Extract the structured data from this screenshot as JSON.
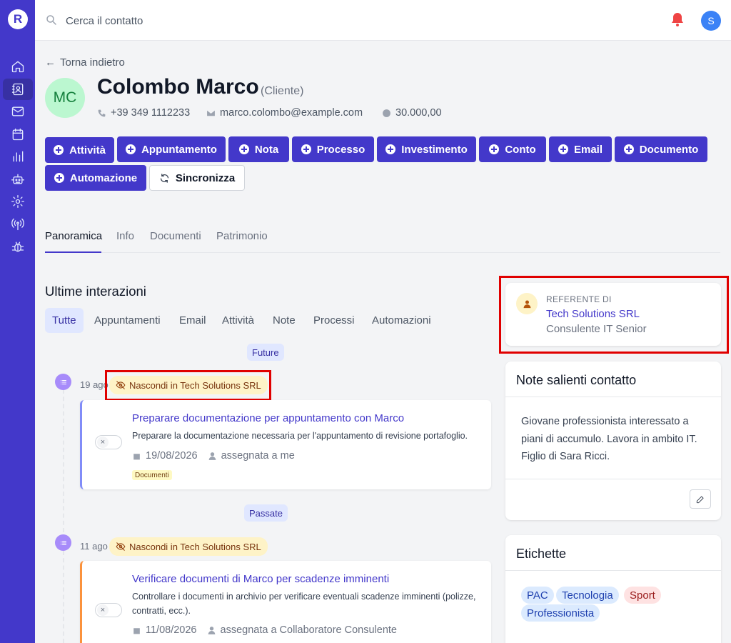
{
  "brand": {
    "logo_letter": "R"
  },
  "search": {
    "placeholder": "Cerca il contatto",
    "value": ""
  },
  "user": {
    "initial": "S"
  },
  "nav": [
    "home-icon",
    "contacts-icon",
    "mail-icon",
    "calendar-icon",
    "chart-icon",
    "robot-icon",
    "settings-icon",
    "antenna-icon",
    "bug-icon"
  ],
  "contact": {
    "back_label": "Torna indietro",
    "initials": "MC",
    "name": "Colombo Marco",
    "type": "(Cliente)",
    "phone": "+39 349 1112233",
    "email": "marco.colombo@example.com",
    "value": "30.000,00"
  },
  "actions": {
    "attivita": "Attività",
    "appuntamento": "Appuntamento",
    "nota": "Nota",
    "processo": "Processo",
    "investimento": "Investimento",
    "conto": "Conto",
    "email": "Email",
    "documento": "Documento",
    "automazione": "Automazione",
    "sincronizza": "Sincronizza"
  },
  "tabs": {
    "panoramica": "Panoramica",
    "info": "Info",
    "documenti": "Documenti",
    "patrimonio": "Patrimonio"
  },
  "interactions": {
    "title": "Ultime interazioni",
    "filters": {
      "tutte": "Tutte",
      "appuntamenti": "Appuntamenti",
      "email": "Email",
      "attivita": "Attività",
      "note": "Note",
      "processi": "Processi",
      "automazioni": "Automazioni"
    },
    "future_label": "Future",
    "past_label": "Passate",
    "items": [
      {
        "date": "19 ago",
        "badge": "Nascondi in Tech Solutions SRL",
        "title": "Preparare documentazione per appuntamento con Marco",
        "description": "Preparare la documentazione necessaria per l'appuntamento di revisione portafoglio.",
        "due": "19/08/2026",
        "assignee": "assegnata a me",
        "tag": "Documenti"
      },
      {
        "date": "11 ago",
        "badge": "Nascondi in Tech Solutions SRL",
        "title": "Verificare documenti di Marco per scadenze imminenti",
        "description": "Controllare i documenti in archivio per verificare eventuali scadenze imminenti (polizze, contratti, ecc.).",
        "due": "11/08/2026",
        "assignee": "assegnata a Collaboratore Consulente"
      }
    ]
  },
  "referente": {
    "label": "REFERENTE DI",
    "company": "Tech Solutions SRL",
    "role": "Consulente IT Senior"
  },
  "notes": {
    "title": "Note salienti contatto",
    "text": "Giovane professionista interessato a piani di accumulo. Lavora in ambito IT. Figlio di Sara Ricci."
  },
  "labels": {
    "title": "Etichette",
    "tags": [
      "PAC",
      "Tecnologia",
      "Sport",
      "Professionista"
    ]
  },
  "colors": {
    "primary": "#4338ca",
    "highlight_box": "#e00000",
    "card1_accent": "#818cf8",
    "card2_accent": "#fb923c"
  }
}
